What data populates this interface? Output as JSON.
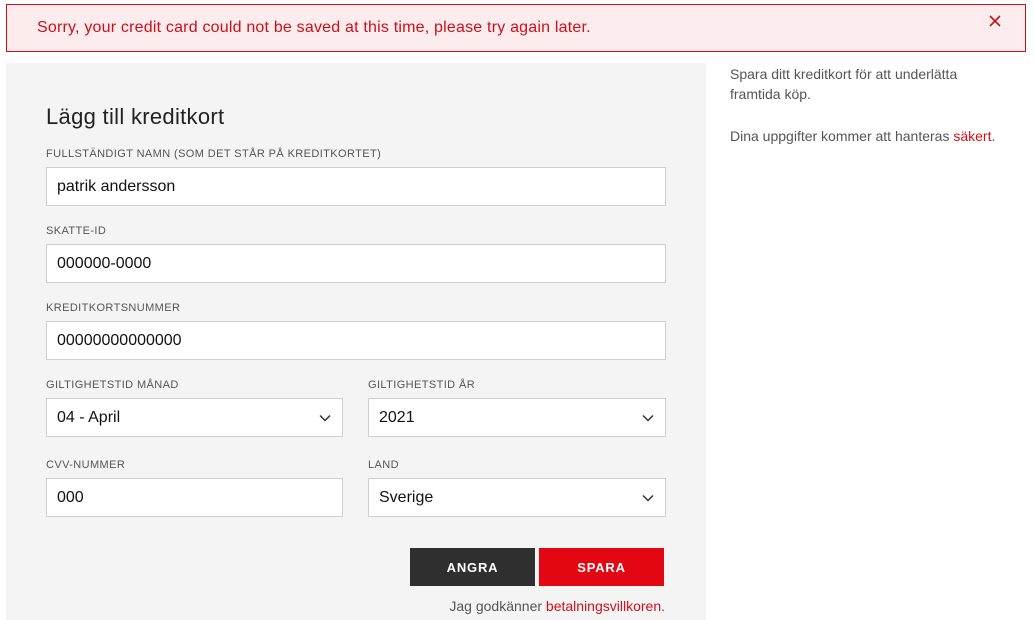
{
  "alert": {
    "message": "Sorry, your credit card could not be saved at this time, please try again later.",
    "close_icon": "close-icon",
    "color": "#cc1019"
  },
  "form": {
    "title": "Lägg till kreditkort",
    "name": {
      "label": "FULLSTÄNDIGT NAMN (SOM DET STÅR PÅ KREDITKORTET)",
      "value": "patrik andersson"
    },
    "tax_id": {
      "label": "SKATTE-ID",
      "value": "000000-0000"
    },
    "card_number": {
      "label": "KREDITKORTSNUMMER",
      "value": "00000000000000"
    },
    "exp_month": {
      "label": "GILTIGHETSTID MÅNAD",
      "value": "04 - April"
    },
    "exp_year": {
      "label": "GILTIGHETSTID ÅR",
      "value": "2021"
    },
    "cvv": {
      "label": "CVV-NUMMER",
      "value": "000"
    },
    "country": {
      "label": "LAND",
      "value": "Sverige"
    },
    "cancel_label": "ANGRA",
    "save_label": "SPARA",
    "terms_prefix": "Jag godkänner ",
    "terms_link": "betalningsvillkoren",
    "terms_suffix": "."
  },
  "side": {
    "info_1": "Spara ditt kreditkort för att underlätta framtida köp.",
    "info_2_prefix": "Dina uppgifter kommer att hanteras ",
    "info_2_link": "säkert",
    "info_2_suffix": "."
  },
  "colors": {
    "accent": "#e30613",
    "dark_button": "#2f2f2f",
    "panel": "#f4f4f4"
  }
}
